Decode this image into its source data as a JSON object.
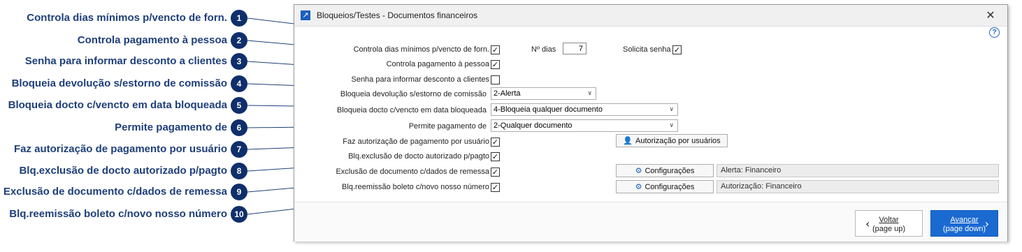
{
  "callouts": [
    {
      "num": "1",
      "text": "Controla dias mínimos p/vencto de forn."
    },
    {
      "num": "2",
      "text": "Controla pagamento à pessoa"
    },
    {
      "num": "3",
      "text": "Senha para informar desconto a clientes"
    },
    {
      "num": "4",
      "text": "Bloqueia devolução s/estorno de comissão"
    },
    {
      "num": "5",
      "text": "Bloqueia docto c/vencto em data bloqueada"
    },
    {
      "num": "6",
      "text": "Permite pagamento de"
    },
    {
      "num": "7",
      "text": "Faz autorização de pagamento por usuário"
    },
    {
      "num": "8",
      "text": "Blq.exclusão de docto autorizado p/pagto"
    },
    {
      "num": "9",
      "text": "Exclusão de documento c/dados de remessa"
    },
    {
      "num": "10",
      "text": "Blq.reemissão boleto c/novo nosso número"
    }
  ],
  "window": {
    "title": "Bloqueios/Testes - Documentos financeiros",
    "close_glyph": "✕",
    "help_glyph": "?",
    "app_icon": "arrow-icon"
  },
  "form": {
    "dias_min_label": "Controla dias mínimos p/vencto de forn.",
    "dias_min_checked": "✓",
    "n_dias_label": "Nº dias",
    "n_dias_value": "7",
    "solicita_senha_label": "Solicita senha",
    "solicita_senha_checked": "✓",
    "pag_pessoa_label": "Controla pagamento à pessoa",
    "pag_pessoa_checked": "✓",
    "senha_desconto_label": "Senha para informar desconto a clientes",
    "senha_desconto_checked": "",
    "bloq_devolucao_label": "Bloqueia devolução s/estorno de comissão",
    "bloq_devolucao_value": "2-Alerta",
    "bloq_docto_label": "Bloqueia docto c/vencto em data bloqueada",
    "bloq_docto_value": "4-Bloqueia qualquer documento",
    "permite_pag_label": "Permite pagamento de",
    "permite_pag_value": "2-Qualquer documento",
    "faz_autoriz_label": "Faz autorização de pagamento por usuário",
    "faz_autoriz_checked": "✓",
    "autoriz_button": "Autorização por usuários",
    "blq_exclusao_label": "Blq.exclusão de docto autorizado p/pagto",
    "blq_exclusao_checked": "✓",
    "exclusao_remessa_label": "Exclusão de documento c/dados de remessa",
    "exclusao_remessa_checked": "✓",
    "config_button_1": "Configurações",
    "config_value_1": "Alerta: Financeiro",
    "blq_reemissao_label": "Blq.reemissão boleto c/novo nosso número",
    "blq_reemissao_checked": "✓",
    "config_button_2": "Configurações",
    "config_value_2": "Autorização: Financeiro",
    "caret": "∨"
  },
  "footer": {
    "back_label": "Voltar",
    "back_sub": "(page up)",
    "back_arrow": "‹",
    "next_label": "Avançar",
    "next_sub": "(page down)",
    "next_arrow": "›"
  },
  "colors": {
    "callout_text": "#1f3f7a",
    "badge": "#0f2f6b",
    "accent": "#1b6ad2"
  }
}
